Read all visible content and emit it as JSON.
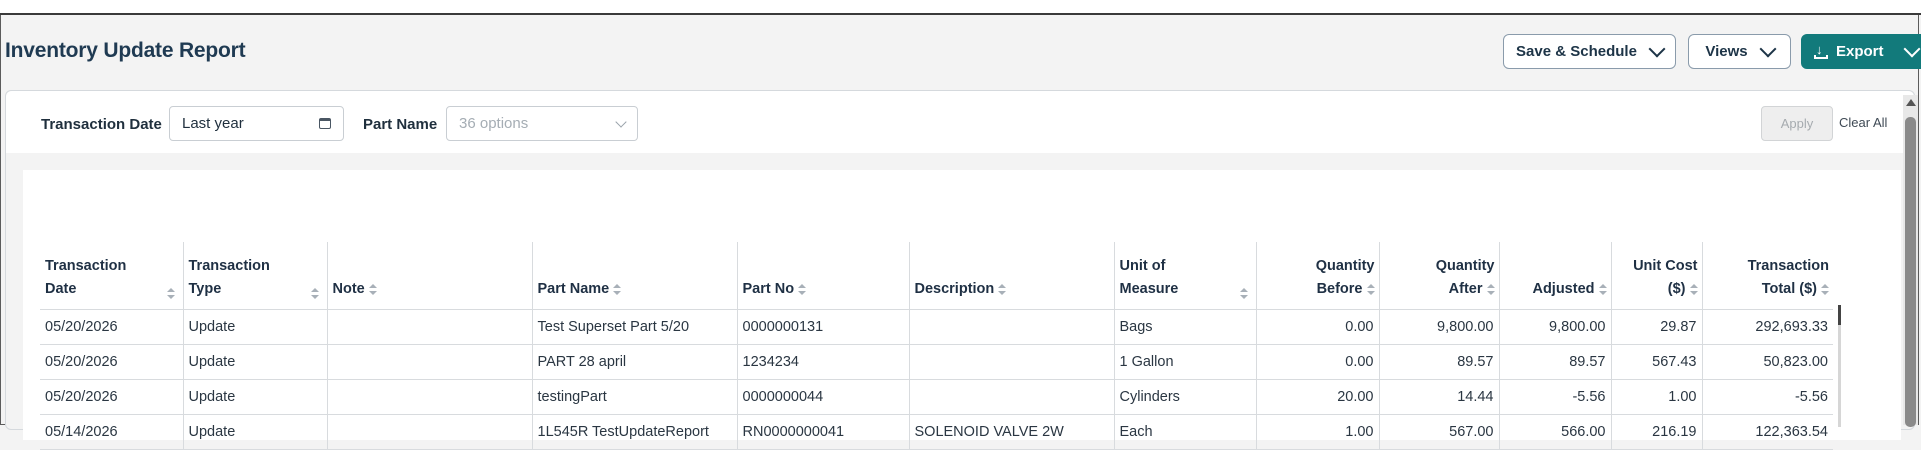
{
  "header": {
    "title": "Inventory Update Report",
    "save_schedule_label": "Save & Schedule",
    "views_label": "Views",
    "export_label": "Export"
  },
  "filters": {
    "transaction_date_label": "Transaction Date",
    "transaction_date_value": "Last year",
    "part_name_label": "Part Name",
    "part_name_placeholder": "36 options",
    "apply_label": "Apply",
    "clear_all_label": "Clear All"
  },
  "table": {
    "columns": [
      {
        "line1": "Transaction",
        "line2": "Date"
      },
      {
        "line1": "Transaction",
        "line2": "Type"
      },
      {
        "line1": "",
        "line2": "Note"
      },
      {
        "line1": "",
        "line2": "Part Name"
      },
      {
        "line1": "",
        "line2": "Part No"
      },
      {
        "line1": "",
        "line2": "Description"
      },
      {
        "line1": "Unit of",
        "line2": "Measure"
      },
      {
        "line1": "Quantity",
        "line2": "Before"
      },
      {
        "line1": "Quantity",
        "line2": "After"
      },
      {
        "line1": "",
        "line2": "Adjusted"
      },
      {
        "line1": "Unit Cost",
        "line2": "($)"
      },
      {
        "line1": "Transaction",
        "line2": "Total ($)"
      }
    ],
    "rows": [
      [
        "05/20/2026",
        "Update",
        "",
        "Test Superset Part 5/20",
        "0000000131",
        "",
        "Bags",
        "0.00",
        "9,800.00",
        "9,800.00",
        "29.87",
        "292,693.33"
      ],
      [
        "05/20/2026",
        "Update",
        "",
        "PART 28 april",
        "1234234",
        "",
        "1 Gallon",
        "0.00",
        "89.57",
        "89.57",
        "567.43",
        "50,823.00"
      ],
      [
        "05/20/2026",
        "Update",
        "",
        "testingPart",
        "0000000044",
        "",
        "Cylinders",
        "20.00",
        "14.44",
        "-5.56",
        "1.00",
        "-5.56"
      ],
      [
        "05/14/2026",
        "Update",
        "",
        "1L545R TestUpdateReport",
        "RN0000000041",
        "SOLENOID VALVE 2W",
        "Each",
        "1.00",
        "567.00",
        "566.00",
        "216.19",
        "122,363.54"
      ]
    ]
  },
  "colors": {
    "accent": "#127a7b",
    "title": "#1f3a52"
  }
}
